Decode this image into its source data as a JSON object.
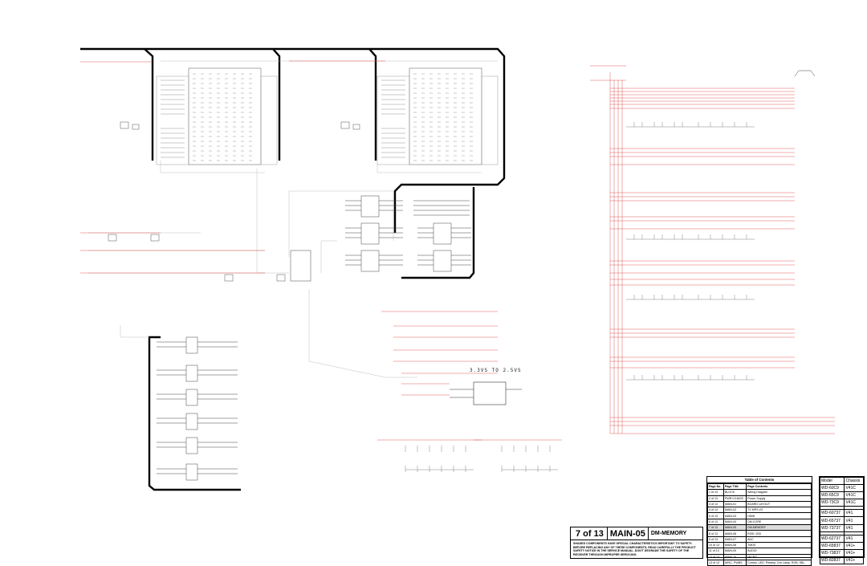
{
  "title_block": {
    "page": "7 of 13",
    "sheet": "MAIN-05",
    "subtitle": "DM-MEMORY",
    "safety_note": "SHADED COMPONENTS HAVE SPECIAL CHARACTERISTICS IMPORTANT TO SAFETY. BEFORE REPLACING ANY OF THESE COMPONENTS, READ CAREFULLY THE PRODUCT SAFETY NOTICE IN THE SERVICE MANUAL. DON'T DEGRADE THE SAFETY OF THE RECEIVER THROUGH IMPROPER SERVICING."
  },
  "toc": {
    "title": "Table of Contents",
    "headers": [
      "Page No.",
      "Page Title",
      "Page Contents"
    ],
    "rows": [
      [
        "1 of 13",
        "BLOCK",
        "Wiring Diagram"
      ],
      [
        "2 of 13",
        "PWR+CHASS",
        "Power Supply"
      ],
      [
        "3 of 13",
        "MAIN-01",
        "BOARD LAYOUT"
      ],
      [
        "4 of 13",
        "MAIN-02",
        "TV MPS I/O"
      ],
      [
        "5 of 13",
        "MAIN-03",
        "HDMI"
      ],
      [
        "6 of 13",
        "MAIN-04",
        "DM-CORE"
      ],
      [
        "7 of 13",
        "MAIN-05",
        "DM-MEMORY"
      ],
      [
        "8 of 13",
        "MAIN-06",
        "RGB / DDI"
      ],
      [
        "9 of 13",
        "MAIN-07",
        "ADC"
      ],
      [
        "10 of 13",
        "MAIN-08",
        "TMDS"
      ],
      [
        "11 of 13",
        "MAIN-09",
        "AUDIO"
      ],
      [
        "12 of 13",
        "MAIN-10",
        "MICRO"
      ],
      [
        "13 of 13",
        "MISC. PWBS",
        "Control, LED, Preamp, Dm Lamp, RGB, SBL"
      ]
    ],
    "active_row": 6
  },
  "models": {
    "headers": [
      "Model",
      "Chassis"
    ],
    "rows": [
      [
        "WD-60C9",
        "V41C"
      ],
      [
        "WD-65C9",
        "V41C"
      ],
      [
        "WD-73C9",
        "V41C"
      ],
      [
        "",
        ""
      ],
      [
        "WD-60737",
        "V41"
      ],
      [
        "WD-65737",
        "V41"
      ],
      [
        "WD-73737",
        "V41"
      ],
      [
        "",
        ""
      ],
      [
        "WD-62737",
        "V41"
      ],
      [
        "WD-65837",
        "V41+"
      ],
      [
        "WD-73837",
        "V41+"
      ],
      [
        "WD-82837",
        "V41+"
      ]
    ]
  },
  "schematic_labels": {
    "regulator": "3.3VS TO 2.5VS"
  },
  "colors": {
    "wire": "#c8c8c8",
    "signal": "#e03030",
    "bus": "#000000"
  }
}
